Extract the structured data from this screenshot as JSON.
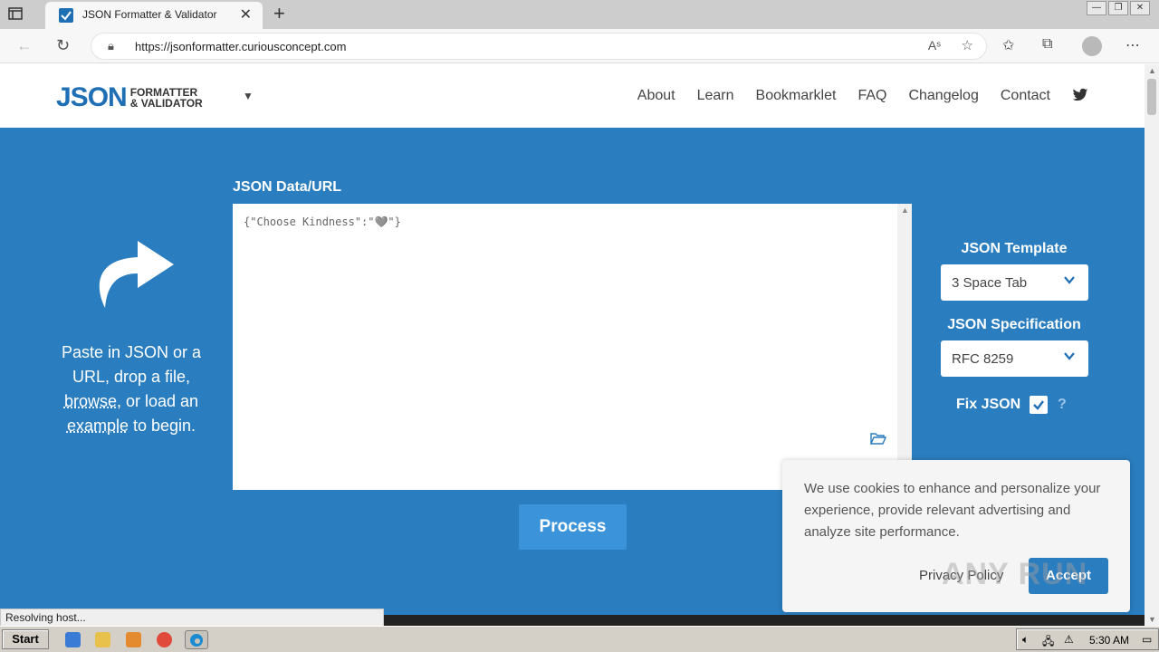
{
  "browser": {
    "tab_title": "JSON Formatter & Validator",
    "close": "✕",
    "new_tab": "+",
    "url_scheme": "https://",
    "url_host": "jsonformatter.curiousconcept.com",
    "read_aloud": "Aˢ",
    "win_min": "—",
    "win_max": "❐",
    "win_close": "✕"
  },
  "site": {
    "logo_big": "JSON",
    "logo_line1": "FORMATTER",
    "logo_line2": "& VALIDATOR",
    "nav": [
      "About",
      "Learn",
      "Bookmarklet",
      "FAQ",
      "Changelog",
      "Contact"
    ]
  },
  "main": {
    "intro_part1": "Paste in JSON or a URL, drop a file, ",
    "browse": "browse",
    "intro_part2": ", or load an ",
    "example": "example",
    "intro_part3": " to begin.",
    "data_label": "JSON Data/URL",
    "editor_content": "{\"Choose Kindness\":\"🩶\"}",
    "process_label": "Process",
    "template_label": "JSON Template",
    "template_value": "3 Space Tab",
    "spec_label": "JSON Specification",
    "spec_value": "RFC 8259",
    "fix_label": "Fix JSON",
    "fix_checked": true,
    "help": "?"
  },
  "cookie": {
    "text": "We use cookies to enhance and personalize your experience, provide relevant advertising and analyze site performance.",
    "privacy": "Privacy Policy",
    "accept": "Accept"
  },
  "status_text": "Resolving host...",
  "taskbar": {
    "start": "Start",
    "time": "5:30 AM"
  },
  "watermark": "ANY RUN",
  "colors": {
    "brand_blue": "#2a7dbe",
    "button_blue": "#3b93da"
  }
}
